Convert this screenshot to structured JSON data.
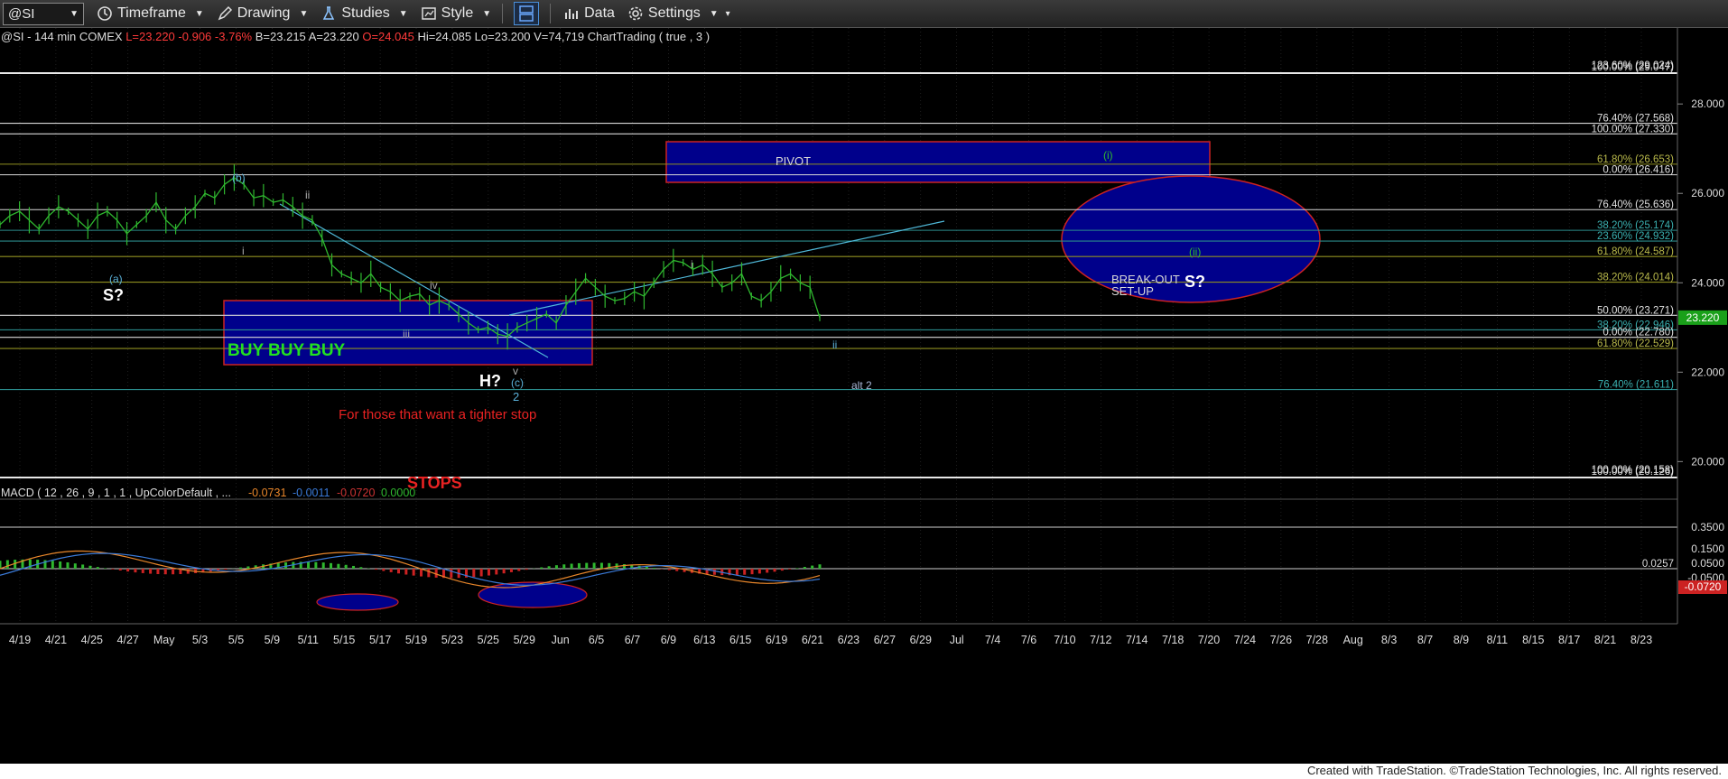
{
  "toolbar": {
    "symbol": "@SI",
    "timeframe": "Timeframe",
    "drawing": "Drawing",
    "studies": "Studies",
    "style": "Style",
    "data": "Data",
    "settings": "Settings"
  },
  "info": {
    "prefix": "@SI - 144 min  COMEX",
    "last": "L=23.220",
    "change": "-0.906",
    "pct": "-3.76%",
    "bid": "B=23.215",
    "ask": "A=23.220",
    "open": "O=24.045",
    "rest": "Hi=24.085  Lo=23.200  V=74,719  ChartTrading ( true , 3 )"
  },
  "macd_info": {
    "label": "MACD ( 12 , 26 , 9 , 1 , 1 , UpColorDefault , ...",
    "v1": "-0.0731",
    "v2": "-0.0011",
    "v3": "-0.0720",
    "v4": "0.0000"
  },
  "footer": "Created with TradeStation. ©TradeStation Technologies, Inc. All rights reserved.",
  "colors": {
    "price": "#2fb82f",
    "fib_white": "#d8d8d8",
    "fib_olive": "#8f8f20",
    "fib_teal": "#2a8a8a",
    "fib_green": "#2a8a40",
    "blue_box": "#00008b",
    "box_border": "#cc2222",
    "wave_label": "#5ab0d8",
    "last_price_bg": "#1aa01a"
  },
  "chart_data": {
    "type": "line",
    "symbol": "@SI",
    "interval": "144 min",
    "exchange": "COMEX",
    "ylim": [
      19.3,
      29.7
    ],
    "price_axis_ticks": [
      "28.000",
      "26.000",
      "24.000",
      "22.000",
      "20.000"
    ],
    "last_price": "23.220",
    "x_tick_labels": [
      "4/19",
      "4/21",
      "4/25",
      "4/27",
      "May",
      "5/3",
      "5/5",
      "5/9",
      "5/11",
      "5/15",
      "5/17",
      "5/19",
      "5/23",
      "5/25",
      "5/29",
      "Jun",
      "6/5",
      "6/7",
      "6/9",
      "6/13",
      "6/15",
      "6/19",
      "6/21",
      "6/23",
      "6/27",
      "6/29",
      "Jul",
      "7/4",
      "7/6",
      "7/10",
      "7/12",
      "7/14",
      "7/18",
      "7/20",
      "7/24",
      "7/26",
      "7/28",
      "Aug",
      "8/3",
      "8/7",
      "8/9",
      "8/11",
      "8/15",
      "8/17",
      "8/21",
      "8/23"
    ],
    "series": [
      {
        "values": [
          25.3,
          25.5,
          25.6,
          25.4,
          25.2,
          25.5,
          25.7,
          25.6,
          25.4,
          25.2,
          25.5,
          25.6,
          25.4,
          25.1,
          25.3,
          25.5,
          25.8,
          25.4,
          25.2,
          25.5,
          25.7,
          26.0,
          25.9,
          26.2,
          26.35,
          26.2,
          25.9,
          25.95,
          25.8,
          25.85,
          25.7,
          25.5,
          25.4,
          25.0,
          24.4,
          24.2,
          24.1,
          24.0,
          24.2,
          23.9,
          23.8,
          23.6,
          23.7,
          23.75,
          23.5,
          23.6,
          23.5,
          23.3,
          23.1,
          22.95,
          23.0,
          22.85,
          22.8,
          23.0,
          23.1,
          23.2,
          23.3,
          23.1,
          23.5,
          23.8,
          24.1,
          23.9,
          23.7,
          23.6,
          23.65,
          23.8,
          23.7,
          24.0,
          24.3,
          24.5,
          24.45,
          24.3,
          24.4,
          24.2,
          23.9,
          24.0,
          24.2,
          23.7,
          23.6,
          23.8,
          24.1,
          24.2,
          24.0,
          23.9,
          23.22
        ]
      }
    ],
    "fib_levels": [
      {
        "label": "123.60% (29.024)"
      },
      {
        "label": "100.00% (29.047)"
      },
      {
        "label": "76.40% (27.568)",
        "value": 27.568
      },
      {
        "label": "100.00% (27.330)",
        "value": 27.33
      },
      {
        "label": "61.80% (26.653)",
        "value": 26.653
      },
      {
        "label": "0.00% (26.416)",
        "value": 26.416
      },
      {
        "label": "76.40% (25.636)",
        "value": 25.636
      },
      {
        "label": "38.20% (25.174)",
        "value": 25.174
      },
      {
        "label": "23.60% (24.932)",
        "value": 24.932
      },
      {
        "label": "61.80% (24.587)",
        "value": 24.587
      },
      {
        "label": "38.20% (24.014)",
        "value": 24.014
      },
      {
        "label": "50.00% (23.271)",
        "value": 23.271
      },
      {
        "label": "38.20% (22.946)",
        "value": 22.946
      },
      {
        "label": "0.00% (22.780)",
        "value": 22.78
      },
      {
        "label": "61.80% (22.529)",
        "value": 22.529
      },
      {
        "label": "76.40% (21.611)",
        "value": 21.611
      },
      {
        "label": "100.00% (20.158)"
      },
      {
        "label": "100.00% (20.126)"
      }
    ],
    "annotations": {
      "pivot": "PIVOT",
      "buy": "BUY BUY BUY",
      "breakout": "BREAK-OUT\nSET-UP",
      "stops": "STOPS",
      "tighter_stop": "For those that want a tighter stop",
      "s_left": "S?",
      "s_right": "S?",
      "h": "H?",
      "wave_a": "(a)",
      "wave_b": "(b)",
      "wave_c": "(c)",
      "wave_i_small": "i",
      "wave_ii_small": "ii",
      "wave_iii": "iii",
      "wave_iv": "iv",
      "wave_v": "v",
      "wave_2": "2",
      "wave_i_right": "i",
      "wave_ii_right": "ii",
      "alt2": "alt 2",
      "wave_i_paren": "(i)",
      "wave_ii_paren": "(ii)"
    },
    "macd": {
      "ticks": [
        "0.3500",
        "0.1500",
        "0.0500",
        "-0.0500"
      ],
      "level_label": "0.0257",
      "last_label": "-0.0720"
    }
  }
}
